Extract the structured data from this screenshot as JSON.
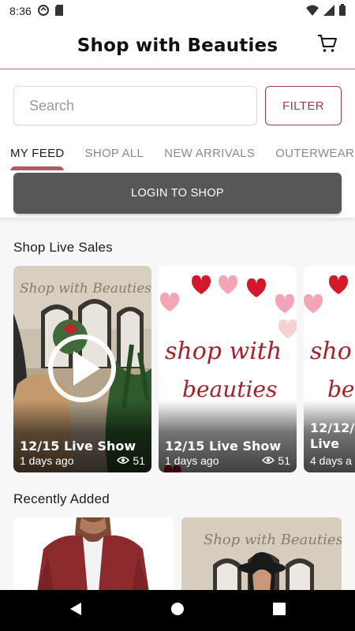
{
  "status_bar": {
    "time": "8:36"
  },
  "header": {
    "title": "Shop with Beauties"
  },
  "search": {
    "placeholder": "Search",
    "value": "",
    "filter_label": "FILTER"
  },
  "tabs": [
    {
      "label": "MY FEED",
      "active": true
    },
    {
      "label": "SHOP ALL",
      "active": false
    },
    {
      "label": "NEW ARRIVALS",
      "active": false
    },
    {
      "label": "OUTERWEAR",
      "active": false
    }
  ],
  "login": {
    "label": "LOGIN TO SHOP"
  },
  "live_sales": {
    "title": "Shop Live Sales",
    "cards": [
      {
        "title": "12/15 Live Show",
        "time": "1 days ago",
        "views": "51"
      },
      {
        "title": "12/15 Live Show",
        "time": "1 days ago",
        "views": "51"
      },
      {
        "title": "12/12/ Live",
        "time": "4 days a",
        "views": ""
      }
    ]
  },
  "recently_added": {
    "title": "Recently Added"
  },
  "colors": {
    "accent": "#a23a4c",
    "tab_indicator": "#b35a66",
    "login_button": "#575757"
  },
  "icons": [
    "cart-icon",
    "play-icon",
    "eye-icon",
    "back-icon",
    "home-icon",
    "recents-icon"
  ]
}
